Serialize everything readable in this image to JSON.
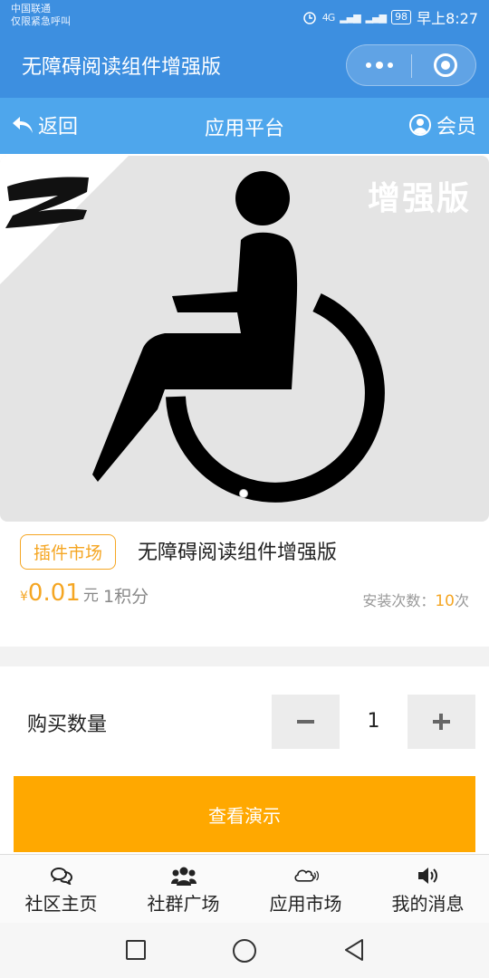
{
  "status_bar": {
    "carrier": "中国联通",
    "emergency": "仅限紧急呼叫",
    "signal": "4G",
    "battery": "98",
    "time": "早上8:27"
  },
  "app_bar": {
    "title": "无障碍阅读组件增强版"
  },
  "nav": {
    "back_label": "返回",
    "title": "应用平台",
    "member_label": "会员"
  },
  "banner": {
    "badge_text": "增强版",
    "logo_letter": "Z",
    "slide_count": 1,
    "active_slide": 1
  },
  "product": {
    "tag": "插件市场",
    "name": "无障碍阅读组件增强版",
    "currency": "¥",
    "price": "0.01",
    "price_unit": "元",
    "points": "1积分",
    "installs_label": "安装次数：",
    "installs_count": "10",
    "installs_suffix": "次"
  },
  "quantity": {
    "label": "购买数量",
    "value": "1"
  },
  "demo_button": {
    "label": "查看演示"
  },
  "tab_bar": {
    "items": [
      {
        "label": "社区主页",
        "icon": "chat-bubbles-icon"
      },
      {
        "label": "社群广场",
        "icon": "users-group-icon"
      },
      {
        "label": "应用市场",
        "icon": "cloud-icon"
      },
      {
        "label": "我的消息",
        "icon": "speaker-icon"
      }
    ]
  },
  "colors": {
    "header_blue": "#3d8fe0",
    "nav_blue": "#4ea6ec",
    "accent_orange": "#ffa800",
    "tag_orange": "#f5a623"
  }
}
